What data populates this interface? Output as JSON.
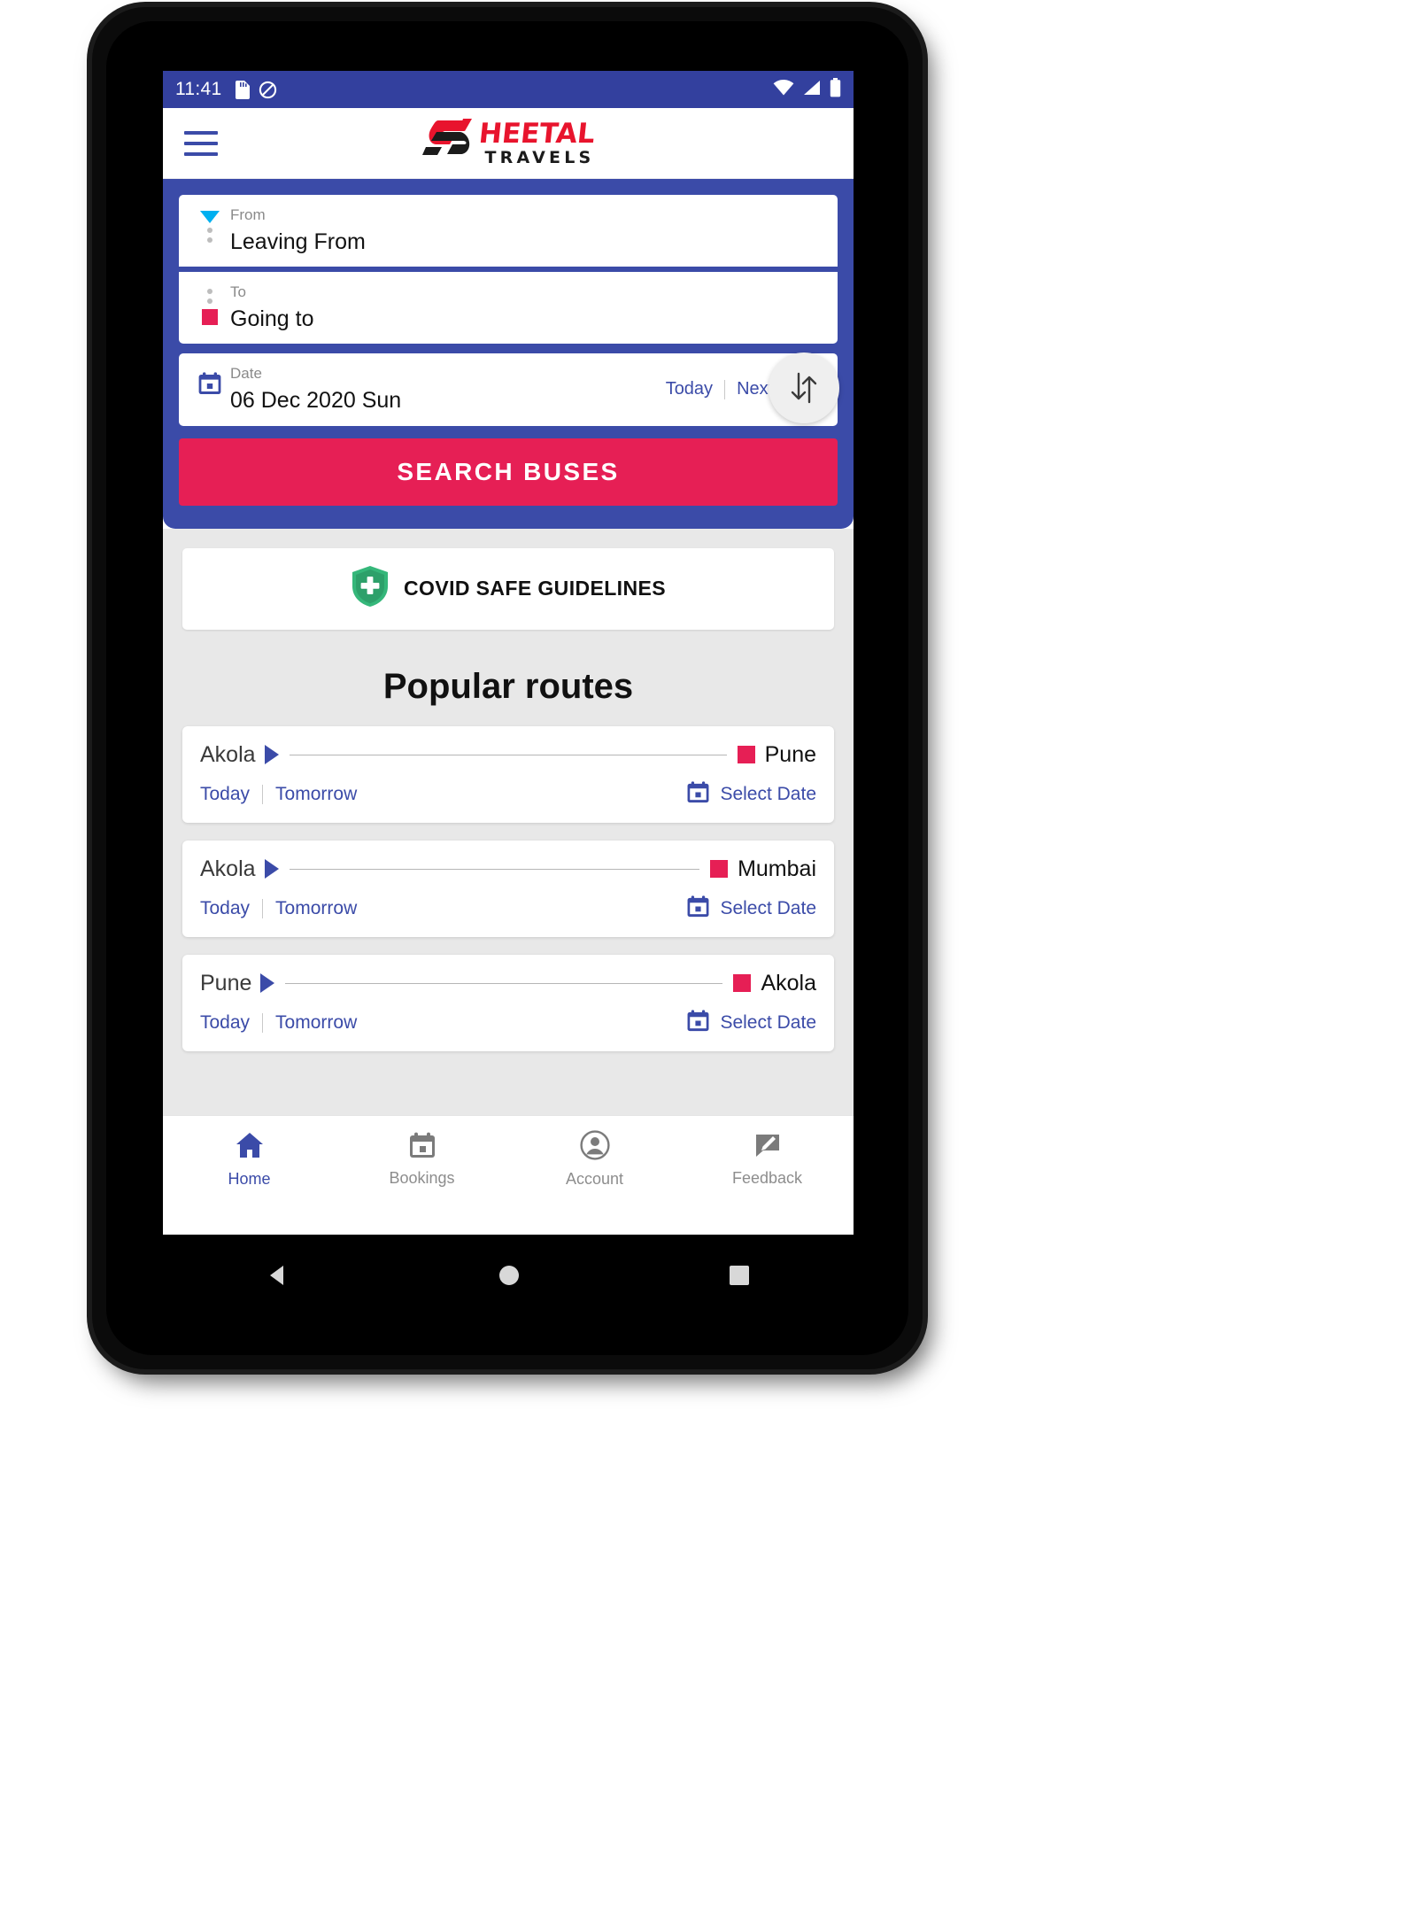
{
  "status_bar": {
    "time": "11:41",
    "left_icons": [
      "sd-card-icon",
      "do-not-disturb-icon"
    ],
    "right_icons": [
      "wifi-icon",
      "signal-icon",
      "battery-icon"
    ]
  },
  "header": {
    "menu_icon": "hamburger-menu-icon",
    "logo_top": "HEETAL",
    "logo_bottom": "TRAVELS",
    "logo_mark": "sheetal-s-mark"
  },
  "search": {
    "from": {
      "label": "From",
      "value": "Leaving From"
    },
    "to": {
      "label": "To",
      "value": "Going to"
    },
    "date": {
      "label": "Date",
      "value": "06 Dec 2020 Sun",
      "today_label": "Today",
      "next_day_label": "Next day"
    },
    "swap_icon": "swap-vertical-icon",
    "search_button": "SEARCH BUSES"
  },
  "covid": {
    "icon": "shield-plus-icon",
    "label": "COVID SAFE GUIDELINES"
  },
  "popular": {
    "title": "Popular routes",
    "routes": [
      {
        "from": "Akola",
        "to": "Pune",
        "today": "Today",
        "tomorrow": "Tomorrow",
        "select_date": "Select Date"
      },
      {
        "from": "Akola",
        "to": "Mumbai",
        "today": "Today",
        "tomorrow": "Tomorrow",
        "select_date": "Select Date"
      },
      {
        "from": "Pune",
        "to": "Akola",
        "today": "Today",
        "tomorrow": "Tomorrow",
        "select_date": "Select Date"
      }
    ]
  },
  "bottom_nav": {
    "items": [
      {
        "label": "Home",
        "icon": "home-icon",
        "active": true
      },
      {
        "label": "Bookings",
        "icon": "calendar-bookings-icon",
        "active": false
      },
      {
        "label": "Account",
        "icon": "account-circle-icon",
        "active": false
      },
      {
        "label": "Feedback",
        "icon": "feedback-edit-icon",
        "active": false
      }
    ]
  },
  "system_nav": {
    "back": "back-triangle-icon",
    "home": "home-circle-icon",
    "recents": "recents-square-icon"
  },
  "colors": {
    "primary_blue": "#3b4ba8",
    "status_blue": "#33409e",
    "accent_pink": "#e61f55",
    "logo_red": "#e8142d",
    "cyan_marker": "#00b0f0",
    "body_grey": "#e8e8e8"
  }
}
